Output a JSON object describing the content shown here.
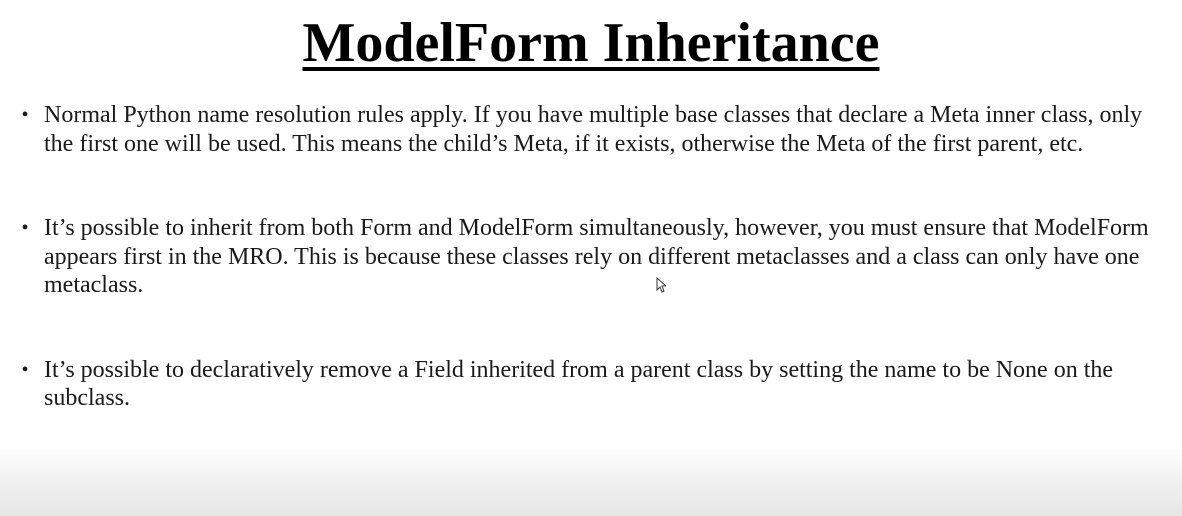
{
  "slide": {
    "title": "ModelForm Inheritance",
    "bullet_symbol": "•",
    "bullets": [
      {
        "text": "Normal Python name resolution rules apply. If you have multiple base classes that declare a Meta inner class, only the first one will be used. This means the child’s Meta, if it exists, otherwise the Meta of the first parent, etc."
      },
      {
        "text": "It’s possible to inherit from both Form and ModelForm simultaneously, however, you must ensure that ModelForm appears first in the MRO. This is because these classes rely on different metaclasses and a class can only have one metaclass."
      },
      {
        "text": "It’s possible to declaratively remove a Field inherited from a parent class by setting the name to be None on the subclass."
      }
    ]
  },
  "icons": {
    "cursor": "mouse-pointer-icon"
  },
  "colors": {
    "text": "#1a1a1a",
    "title": "#000000",
    "background": "#ffffff"
  }
}
